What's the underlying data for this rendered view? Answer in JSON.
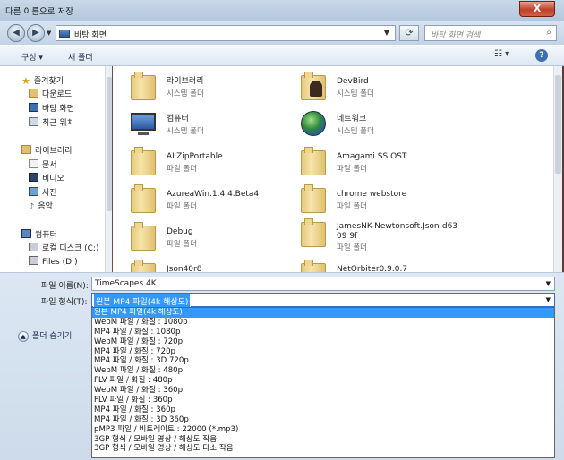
{
  "window": {
    "title": "다른 이름으로 저장",
    "close": "X"
  },
  "address": {
    "path": "바탕 화면",
    "search_placeholder": "바탕 화면 검색"
  },
  "toolbar": {
    "organize": "구성 ▾",
    "new_folder": "새 폴더"
  },
  "sidebar": {
    "favorites": {
      "label": "즐겨찾기",
      "items": [
        "다운로드",
        "바탕 화면",
        "최근 위치"
      ]
    },
    "libraries": {
      "label": "라이브러리",
      "items": [
        "문서",
        "비디오",
        "사진",
        "음악"
      ]
    },
    "computer": {
      "label": "컴퓨터",
      "items": [
        "로컬 디스크 (C:)",
        "Files (D:)"
      ]
    }
  },
  "files": [
    {
      "name": "라이브러리",
      "sub": "시스템 폴더"
    },
    {
      "name": "DevBird",
      "sub": "시스템 폴더"
    },
    {
      "name": "컴퓨터",
      "sub": "시스템 폴더"
    },
    {
      "name": "네트워크",
      "sub": "시스템 폴더"
    },
    {
      "name": "ALZipPortable",
      "sub": "파일 폴더"
    },
    {
      "name": "Amagami SS OST",
      "sub": "파일 폴더"
    },
    {
      "name": "AzureaWin.1.4.4.Beta4",
      "sub": "파일 폴더"
    },
    {
      "name": "chrome webstore",
      "sub": "파일 폴더"
    },
    {
      "name": "Debug",
      "sub": "파일 폴더"
    },
    {
      "name": "JamesNK-Newtonsoft.Json-d6309 9f",
      "sub": "파일 폴더"
    },
    {
      "name": "Json40r8",
      "sub": ""
    },
    {
      "name": "NetOrbiter0.9.0.7",
      "sub": ""
    }
  ],
  "form": {
    "filename_label": "파일 이름(N):",
    "filename_value": "TimeScapes 4K",
    "filetype_label": "파일 형식(T):",
    "filetype_value": "원본 MP4 파일(4k 해상도)",
    "hide_folders": "폴더 숨기기"
  },
  "filetype_options": [
    "원본 MP4 파일(4k 해상도)",
    "WebM 파일 / 화질 : 1080p",
    "MP4 파일 / 화질 : 1080p",
    "WebM 파일 / 화질 : 720p",
    "MP4 파일 / 화질 : 720p",
    "MP4 파일 / 화질 : 3D 720p",
    "WebM 파일 / 화질 : 480p",
    "FLV 파일 / 화질 : 480p",
    "WebM 파일 / 화질 : 360p",
    "FLV 파일 / 화질 : 360p",
    "MP4 파일 / 화질 : 360p",
    "MP4 파일 / 화질 : 3D 360p",
    "pMP3 파일 / 비트레이트 : 22000 (*.mp3)",
    "3GP 형식 / 모바일 영상 / 해상도 작음",
    "3GP 형식 / 모바일 영상 / 해상도 다소 작음"
  ]
}
